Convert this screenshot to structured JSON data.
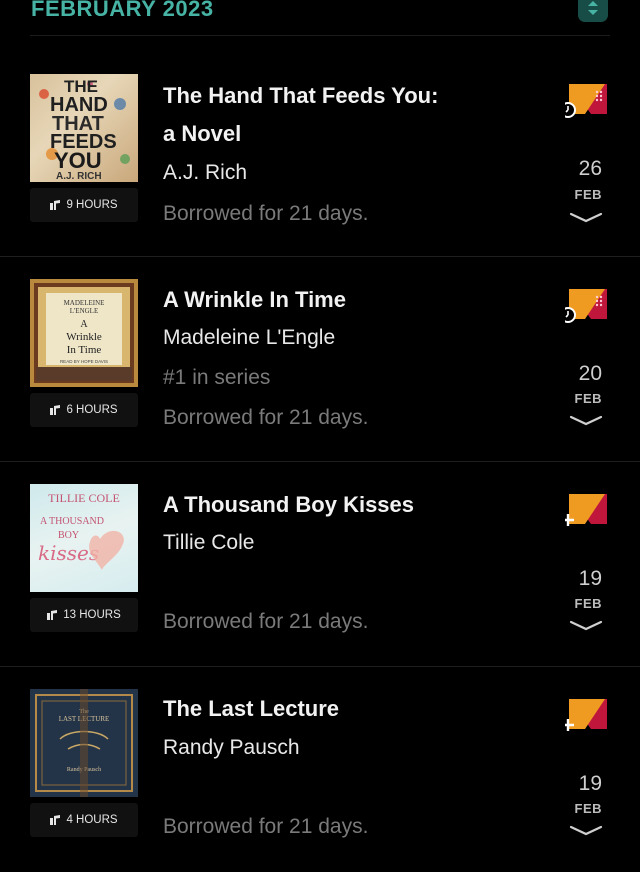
{
  "header": {
    "month": "FEBRUARY 2023",
    "sort_icon": "sort-updown-icon",
    "accent": "#46b3a4"
  },
  "books": [
    {
      "title_line1": "The Hand That Feeds You:",
      "title_line2": "a Novel",
      "author": "A.J. Rich",
      "series": "",
      "borrowed": "Borrowed for 21 days.",
      "duration": "9 HOURS",
      "day": "26",
      "month": "FEB",
      "badge": "timer",
      "cover": {
        "line1": "THE",
        "line2": "HAND",
        "line3": "THAT",
        "line4": "FEEDS",
        "line5": "YOU",
        "author": "A.J. RICH"
      }
    },
    {
      "title_line1": "A Wrinkle In Time",
      "title_line2": "",
      "author": "Madeleine L'Engle",
      "series": "#1 in series",
      "borrowed": "Borrowed for 21 days.",
      "duration": "6 HOURS",
      "day": "20",
      "month": "FEB",
      "badge": "timer",
      "cover": {
        "line1": "MADELEINE",
        "line2": "L'ENGLE",
        "line3": "A",
        "line4": "Wrinkle",
        "line5": "In Time",
        "author": "READ BY HOPE DAVIS"
      }
    },
    {
      "title_line1": "A Thousand Boy Kisses",
      "title_line2": "",
      "author": "Tillie Cole",
      "series": "",
      "borrowed": "Borrowed for 21 days.",
      "duration": "13 HOURS",
      "day": "19",
      "month": "FEB",
      "badge": "plus",
      "cover": {
        "line1": "TILLIE COLE",
        "line2": "A THOUSAND",
        "line3": "BOY",
        "line4": "kisses"
      }
    },
    {
      "title_line1": "The Last Lecture",
      "title_line2": "",
      "author": "Randy Pausch",
      "series": "",
      "borrowed": "Borrowed for 21 days.",
      "duration": "4 HOURS",
      "day": "19",
      "month": "FEB",
      "badge": "plus",
      "cover": {
        "line1": "The",
        "line2": "LAST LECTURE",
        "line3": "Randy Pausch"
      }
    }
  ]
}
